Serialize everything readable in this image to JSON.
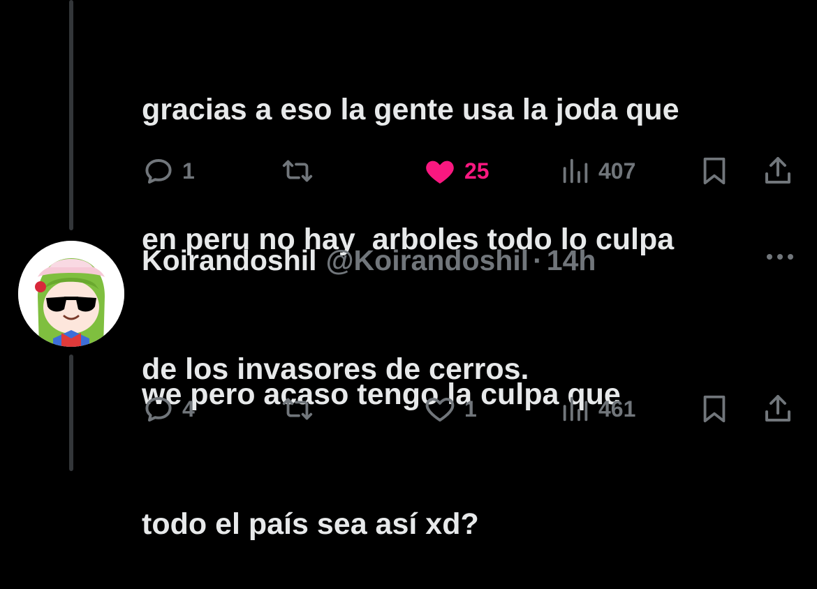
{
  "previous_tweet": {
    "text_lines": [
      "gracias a eso la gente usa la joda que",
      "en peru no hay  arboles todo lo culpa",
      "de los invasores de cerros."
    ],
    "actions": {
      "replies": "1",
      "reposts": "",
      "likes": "25",
      "liked": true,
      "views": "407"
    }
  },
  "reply_tweet": {
    "author_name": "Koirandoshil",
    "author_handle": "@Koirandoshil",
    "separator": "·",
    "time": "14h",
    "text_lines": [
      "we pero acaso tengo la culpa que",
      "todo el país sea así xd?"
    ],
    "actions": {
      "replies": "4",
      "reposts": "",
      "likes": "1",
      "liked": false,
      "views": "461"
    }
  },
  "colors": {
    "background": "#000000",
    "text_primary": "#e7e9ea",
    "text_secondary": "#71767b",
    "like_active": "#f91880",
    "thread_line": "#333639"
  },
  "icons": [
    "reply-icon",
    "repost-icon",
    "heart-icon",
    "views-icon",
    "bookmark-icon",
    "share-icon",
    "more-icon"
  ]
}
